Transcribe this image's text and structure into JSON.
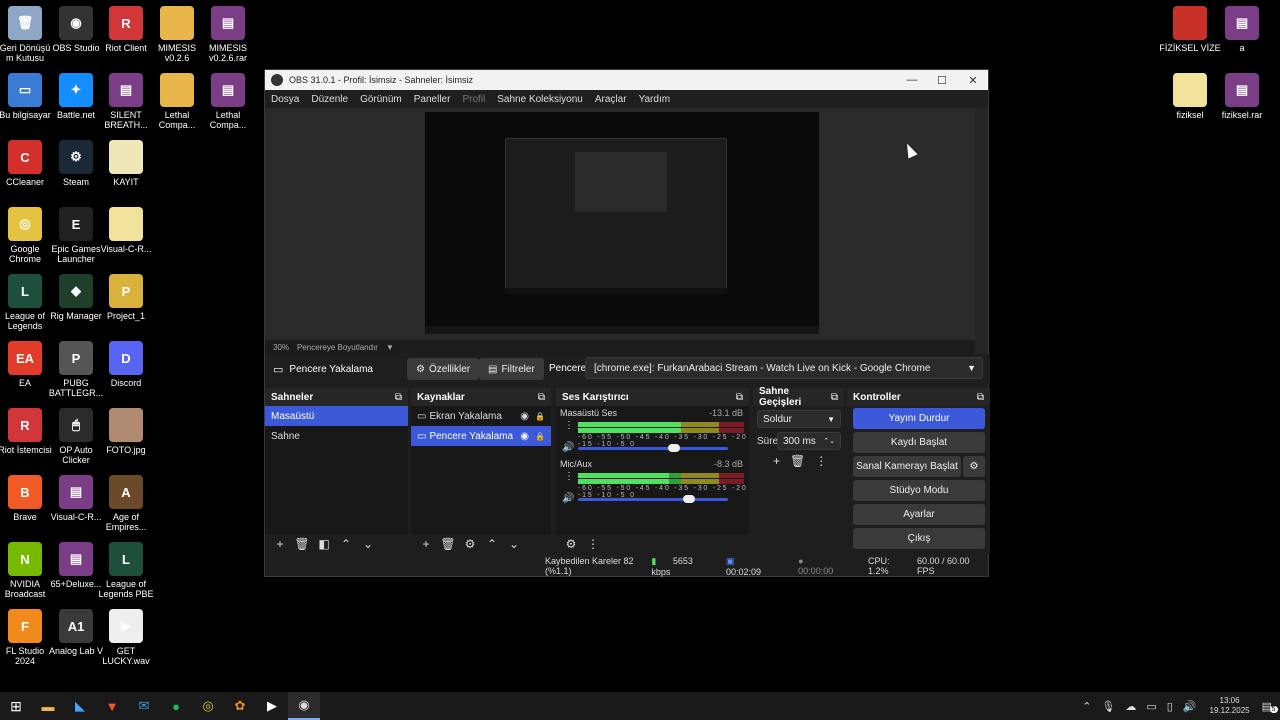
{
  "desktop": {
    "icons": [
      {
        "label": "Geri Dönüşü\nm Kutusu",
        "icon": "recycle-bin-icon",
        "color": "#8fa7c6",
        "glyph": "🗑"
      },
      {
        "label": "OBS Studio",
        "icon": "obs-icon",
        "color": "#333333",
        "glyph": "◉"
      },
      {
        "label": "Riot Client",
        "icon": "riot-icon",
        "color": "#d13639",
        "glyph": "R"
      },
      {
        "label": "MIMESIS\nv0.2.6",
        "icon": "folder-icon",
        "color": "#e8b64a",
        "glyph": ""
      },
      {
        "label": "MIMESIS\nv0.2.6.rar",
        "icon": "winrar-icon",
        "color": "#7a3d86",
        "glyph": "▤"
      },
      {
        "label": "Bu bilgisayar",
        "icon": "computer-icon",
        "color": "#3a7bd5",
        "glyph": "▭"
      },
      {
        "label": "Battle.net",
        "icon": "battlenet-icon",
        "color": "#148eff",
        "glyph": "✦"
      },
      {
        "label": "SILENT\nBREATH...",
        "icon": "winrar-icon",
        "color": "#7a3d86",
        "glyph": "▤"
      },
      {
        "label": "Lethal\nCompa...",
        "icon": "folder-icon",
        "color": "#e8b64a",
        "glyph": ""
      },
      {
        "label": "Lethal\nCompa...",
        "icon": "winrar-icon",
        "color": "#7a3d86",
        "glyph": "▤"
      },
      {
        "label": "CCleaner",
        "icon": "ccleaner-icon",
        "color": "#d3302b",
        "glyph": "C"
      },
      {
        "label": "Steam",
        "icon": "steam-icon",
        "color": "#1b2838",
        "glyph": "⚙"
      },
      {
        "label": "KAYIT",
        "icon": "text-file-icon",
        "color": "#efe7b8",
        "glyph": ""
      },
      {
        "label": "Google\nChrome",
        "icon": "chrome-icon",
        "color": "#e3c341",
        "glyph": "◎"
      },
      {
        "label": "Epic Games\nLauncher",
        "icon": "epic-icon",
        "color": "#222222",
        "glyph": "E"
      },
      {
        "label": "Visual-C-R...",
        "icon": "folder-icon",
        "color": "#f1e29b",
        "glyph": ""
      },
      {
        "label": "League of\nLegends",
        "icon": "league-icon",
        "color": "#1d4f3c",
        "glyph": "L"
      },
      {
        "label": "Rig Manager",
        "icon": "rig-icon",
        "color": "#1f3f2a",
        "glyph": "◆"
      },
      {
        "label": "Project_1",
        "icon": "project-icon",
        "color": "#d8b23a",
        "glyph": "P"
      },
      {
        "label": "EA",
        "icon": "ea-icon",
        "color": "#e23b2a",
        "glyph": "EA"
      },
      {
        "label": "PUBG\nBATTLEGR...",
        "icon": "pubg-icon",
        "color": "#555555",
        "glyph": "P"
      },
      {
        "label": "Discord",
        "icon": "discord-icon",
        "color": "#5865f2",
        "glyph": "D"
      },
      {
        "label": "Riot İstemcisi",
        "icon": "riot-icon",
        "color": "#d13639",
        "glyph": "R"
      },
      {
        "label": "OP Auto\nClicker",
        "icon": "mouse-icon",
        "color": "#2b2b2b",
        "glyph": "🖱"
      },
      {
        "label": "FOTO.jpg",
        "icon": "image-icon",
        "color": "#b08a70",
        "glyph": ""
      },
      {
        "label": "Brave",
        "icon": "brave-icon",
        "color": "#f15a24",
        "glyph": "B"
      },
      {
        "label": "Visual-C-R...",
        "icon": "winrar-icon",
        "color": "#7a3d86",
        "glyph": "▤"
      },
      {
        "label": "Age of\nEmpires...",
        "icon": "aoe-icon",
        "color": "#6b4a2a",
        "glyph": "A"
      },
      {
        "label": "NVIDIA\nBroadcast",
        "icon": "nvidia-icon",
        "color": "#76b900",
        "glyph": "N"
      },
      {
        "label": "65+Deluxe...",
        "icon": "winrar-icon",
        "color": "#7a3d86",
        "glyph": "▤"
      },
      {
        "label": "League of\nLegends PBE",
        "icon": "league-icon",
        "color": "#1d4f3c",
        "glyph": "L"
      },
      {
        "label": "FL Studio\n2024",
        "icon": "fl-studio-icon",
        "color": "#f08a1c",
        "glyph": "F"
      },
      {
        "label": "Analog Lab V",
        "icon": "analog-lab-icon",
        "color": "#3a3a3a",
        "glyph": "A1"
      },
      {
        "label": "GET\nLUCKY.wav",
        "icon": "audio-file-icon",
        "color": "#eeeeee",
        "glyph": "▶"
      },
      {
        "label": "FİZİKSEL VİZE",
        "icon": "pdf-icon",
        "color": "#c8302a",
        "glyph": ""
      },
      {
        "label": "a",
        "icon": "winrar-icon",
        "color": "#7a3d86",
        "glyph": "▤"
      },
      {
        "label": "fiziksel",
        "icon": "folder-icon",
        "color": "#f1e29b",
        "glyph": ""
      },
      {
        "label": "fiziksel.rar",
        "icon": "winrar-icon",
        "color": "#7a3d86",
        "glyph": "▤"
      }
    ]
  },
  "obs": {
    "title": "OBS 31.0.1 - Profil: İsimsiz - Sahneler: İsimsiz",
    "menu": [
      "Dosya",
      "Düzenle",
      "Görünüm",
      "Paneller",
      "Profil",
      "Sahne Koleksiyonu",
      "Araçlar",
      "Yardım"
    ],
    "zoom": "30%",
    "zoom_mode": "Pencereye Boyutlandır",
    "source_name": "Pencere Yakalama",
    "properties_label": "Özellikler",
    "filters_label": "Filtreler",
    "window_label": "Pencere",
    "window_value": "[chrome.exe]: FurkanArabaci Stream - Watch Live on Kick - Google Chrome",
    "scenes": {
      "title": "Sahneler",
      "items": [
        "Masaüstü",
        "Sahne"
      ]
    },
    "sources": {
      "title": "Kaynaklar",
      "items": [
        "Ekran Yakalama",
        "Pencere Yakalama"
      ]
    },
    "mixer": {
      "title": "Ses Karıştırıcı",
      "scale": "-60 -55 -50 -45 -40 -35 -30 -25 -20 -15 -10 -5 0",
      "channels": [
        {
          "name": "Masaüstü Ses",
          "db": "-13.1 dB",
          "level": 0.62,
          "volume": 0.64
        },
        {
          "name": "Mic/Aux",
          "db": "-8.3 dB",
          "level": 0.55,
          "volume": 0.74
        }
      ]
    },
    "transitions": {
      "title": "Sahne Geçişleri",
      "type": "Soldur",
      "duration_label": "Süre",
      "duration": "300 ms"
    },
    "controls": {
      "title": "Kontroller",
      "stop_stream": "Yayını Durdur",
      "start_record": "Kaydı Başlat",
      "virtual_cam": "Sanal Kamerayı Başlat",
      "studio_mode": "Stüdyo Modu",
      "settings": "Ayarlar",
      "exit": "Çıkış"
    },
    "status": {
      "dropped": "Kaybedilen Kareler 82 (%1.1)",
      "bitrate": "5653 kbps",
      "stream_time": "00:02:09",
      "record_time": "00:00:00",
      "cpu": "CPU: 1.2%",
      "fps": "60.00 / 60.00 FPS"
    }
  },
  "taskbar": {
    "clock_time": "13:06",
    "clock_date": "19.12.2025",
    "notif_count": "5"
  }
}
